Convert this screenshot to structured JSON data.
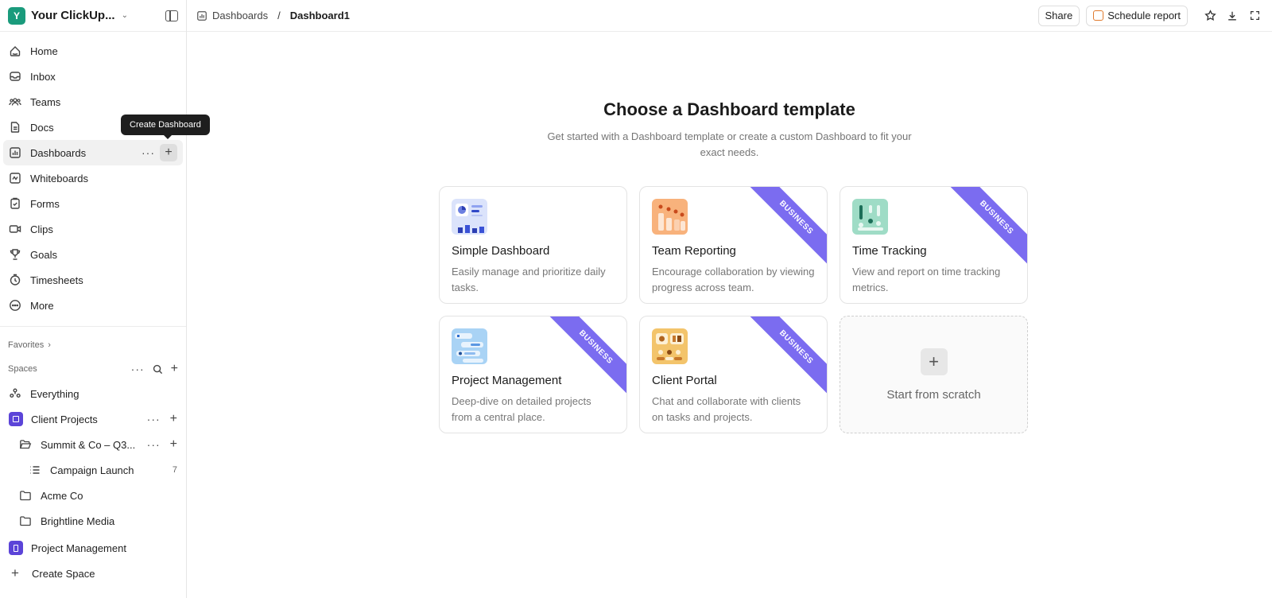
{
  "workspace": {
    "initial": "Y",
    "name": "Your ClickUp..."
  },
  "tooltip": "Create Dashboard",
  "nav": [
    {
      "label": "Home",
      "icon": "home-icon"
    },
    {
      "label": "Inbox",
      "icon": "inbox-icon"
    },
    {
      "label": "Teams",
      "icon": "teams-icon"
    },
    {
      "label": "Docs",
      "icon": "docs-icon"
    },
    {
      "label": "Dashboards",
      "icon": "dashboards-icon"
    },
    {
      "label": "Whiteboards",
      "icon": "whiteboards-icon"
    },
    {
      "label": "Forms",
      "icon": "forms-icon"
    },
    {
      "label": "Clips",
      "icon": "clips-icon"
    },
    {
      "label": "Goals",
      "icon": "goals-icon"
    },
    {
      "label": "Timesheets",
      "icon": "timesheets-icon"
    },
    {
      "label": "More",
      "icon": "more-icon"
    }
  ],
  "favorites_label": "Favorites",
  "spaces_label": "Spaces",
  "spaces": {
    "everything": "Everything",
    "client_projects": "Client Projects",
    "summit": "Summit & Co – Q3...",
    "campaign": "Campaign Launch",
    "campaign_count": "7",
    "acme": "Acme Co",
    "brightline": "Brightline Media",
    "project_management": "Project Management",
    "create_space": "Create Space"
  },
  "breadcrumb": {
    "parent": "Dashboards",
    "separator": "/",
    "current": "Dashboard1"
  },
  "topbar": {
    "share": "Share",
    "schedule": "Schedule report"
  },
  "main": {
    "title": "Choose a Dashboard template",
    "subtitle": "Get started with a Dashboard template or create a custom Dashboard to fit your exact needs."
  },
  "cards": [
    {
      "title": "Simple Dashboard",
      "desc": "Easily manage and prioritize daily tasks.",
      "ribbon": ""
    },
    {
      "title": "Team Reporting",
      "desc": "Encourage collaboration by viewing progress across team.",
      "ribbon": "BUSINESS"
    },
    {
      "title": "Time Tracking",
      "desc": "View and report on time tracking metrics.",
      "ribbon": "BUSINESS"
    },
    {
      "title": "Project Management",
      "desc": "Deep-dive on detailed projects from a central place.",
      "ribbon": "BUSINESS"
    },
    {
      "title": "Client Portal",
      "desc": "Chat and collaborate with clients on tasks and projects.",
      "ribbon": "BUSINESS"
    }
  ],
  "scratch": {
    "label": "Start from scratch"
  },
  "colors": {
    "brand": "#1a9b7c",
    "ribbon": "#7b6cf0",
    "space_badge": "#5b44d8"
  }
}
